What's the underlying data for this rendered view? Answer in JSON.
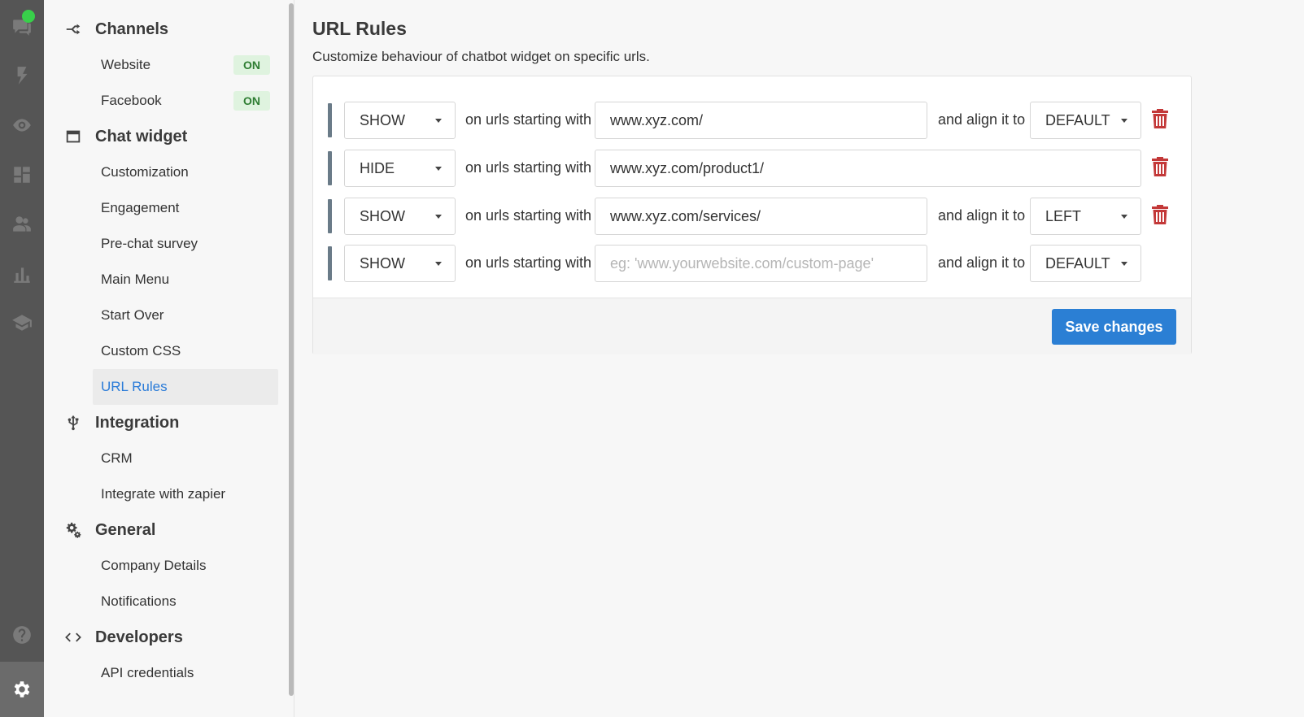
{
  "rail": {
    "icons": [
      "chat-icon",
      "lightning-icon",
      "eye-icon",
      "dashboard-icon",
      "people-icon",
      "bar-chart-icon",
      "graduation-cap-icon",
      "help-icon",
      "gear-icon"
    ],
    "active": "gear-icon"
  },
  "sidebar": {
    "channels": {
      "title": "Channels",
      "website": "Website",
      "website_badge": "ON",
      "facebook": "Facebook",
      "facebook_badge": "ON"
    },
    "chat_widget": {
      "title": "Chat widget",
      "items": [
        "Customization",
        "Engagement",
        "Pre-chat survey",
        "Main Menu",
        "Start Over",
        "Custom CSS",
        "URL Rules"
      ]
    },
    "integration": {
      "title": "Integration",
      "items": [
        "CRM",
        "Integrate with zapier"
      ]
    },
    "general": {
      "title": "General",
      "items": [
        "Company Details",
        "Notifications"
      ]
    },
    "developers": {
      "title": "Developers",
      "items": [
        "API credentials"
      ]
    }
  },
  "main": {
    "title": "URL Rules",
    "subtitle": "Customize behaviour of chatbot widget on specific urls.",
    "connector_text": "on urls starting with",
    "align_text": "and align it to",
    "save_label": "Save changes",
    "rules": [
      {
        "action": "SHOW",
        "url": "www.xyz.com/",
        "align": "DEFAULT"
      },
      {
        "action": "HIDE",
        "url": "www.xyz.com/product1/"
      },
      {
        "action": "SHOW",
        "url": "www.xyz.com/services/",
        "align": "LEFT"
      },
      {
        "action": "SHOW",
        "url": "",
        "placeholder": "eg: 'www.yourwebsite.com/custom-page'",
        "align": "DEFAULT"
      }
    ]
  },
  "colors": {
    "accent": "#2b7fd4",
    "rail_bg": "#555555",
    "badge_green": "#2e7d32",
    "delete_red": "#c33838",
    "online": "#38d04a"
  }
}
